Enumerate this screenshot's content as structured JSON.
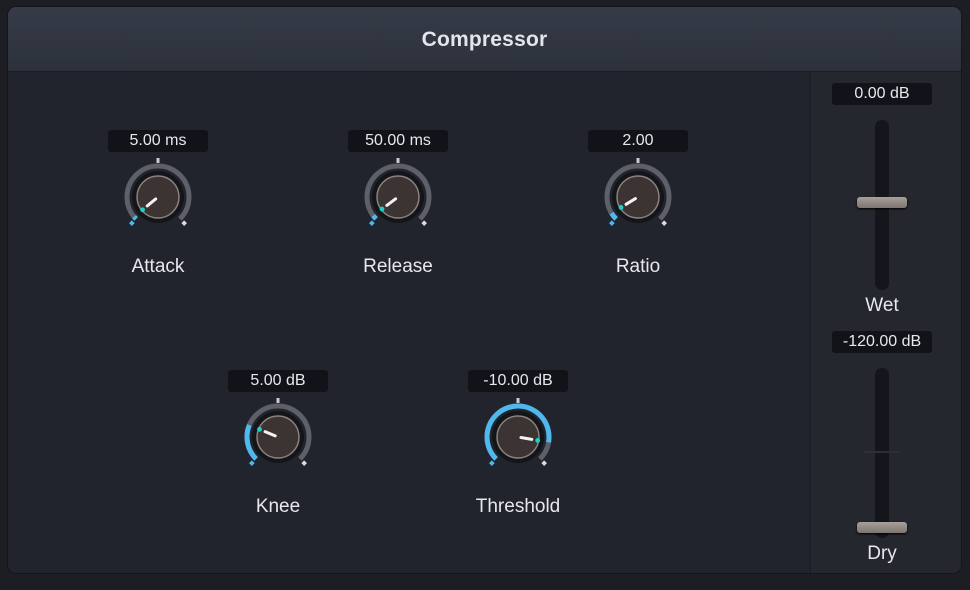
{
  "title": "Compressor",
  "colors": {
    "accent": "#4fb8ec",
    "indicator": "#1fd0c8",
    "panel": "#23252e",
    "header": "#323743"
  },
  "knobs": [
    {
      "id": "attack",
      "label": "Attack",
      "value": "5.00 ms",
      "fraction": 0.02
    },
    {
      "id": "release",
      "label": "Release",
      "value": "50.00 ms",
      "fraction": 0.03
    },
    {
      "id": "ratio",
      "label": "Ratio",
      "value": "2.00",
      "fraction": 0.05
    },
    {
      "id": "knee",
      "label": "Knee",
      "value": "5.00 dB",
      "fraction": 0.25
    },
    {
      "id": "threshold",
      "label": "Threshold",
      "value": "-10.00 dB",
      "fraction": 0.87
    }
  ],
  "sliders": [
    {
      "id": "wet",
      "label": "Wet",
      "value": "0.00 dB",
      "fraction": 0.5
    },
    {
      "id": "dry",
      "label": "Dry",
      "value": "-120.00 dB",
      "fraction": 0.0
    }
  ]
}
